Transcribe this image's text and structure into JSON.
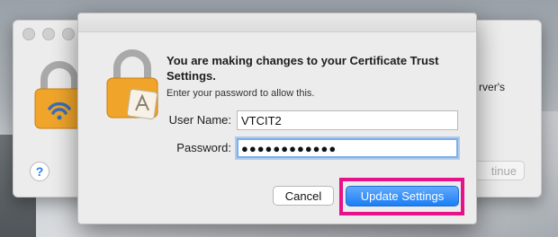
{
  "dialog": {
    "title": "You are making changes to your Certificate Trust Settings.",
    "subtitle": "Enter your password to allow this.",
    "user_name_label": "User Name:",
    "user_name_value": "VTCIT2",
    "password_label": "Password:",
    "password_value": "●●●●●●●●●●●●",
    "cancel_label": "Cancel",
    "update_label": "Update Settings"
  },
  "background_window": {
    "partial_text": "rver's",
    "continue_label": "tinue",
    "help_label": "?"
  },
  "colors": {
    "highlight": "#e5128a",
    "primary_button": "#1a7ff4",
    "focus_ring": "#7ab0ee"
  },
  "icons": {
    "back_lock": "padlock-wifi-icon",
    "front_lock": "padlock-certificate-icon"
  }
}
